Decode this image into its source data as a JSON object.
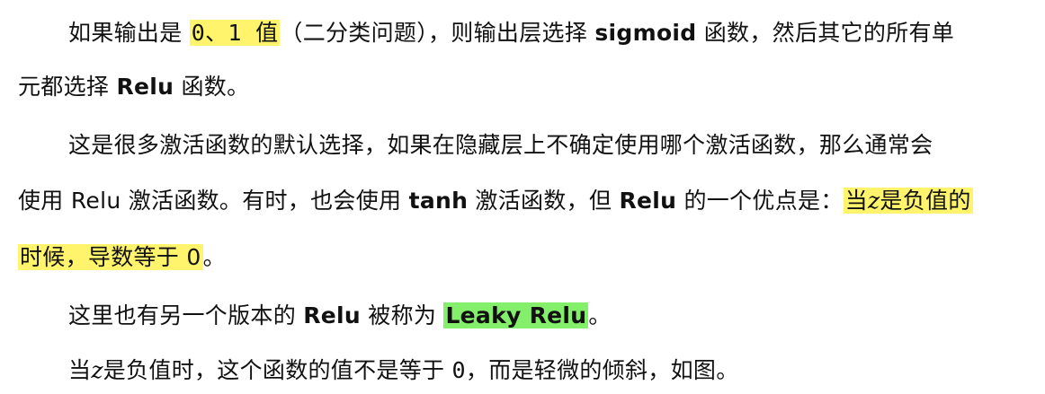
{
  "colors": {
    "highlight_yellow": "#fff46b",
    "highlight_green": "#84ef6a",
    "text": "#111111",
    "background": "#ffffff"
  },
  "p1": {
    "t1": "如果输出是 ",
    "hl": "0、1 值",
    "t2": "（二分类问题），则输出层选择 ",
    "b1": "sigmoid",
    "t3": " 函数，然后其它的所有单",
    "line2_t1": "元都选择 ",
    "line2_b1": "Relu",
    "line2_t2": " 函数。"
  },
  "p2": {
    "t1": "这是很多激活函数的默认选择，如果在隐藏层上不确定使用哪个激活函数，那么通常会",
    "line2_t1": "使用 Relu 激活函数。有时，也会使用 ",
    "line2_b1": "tanh",
    "line2_t2": " 激活函数，但 ",
    "line2_b2": "Relu",
    "line2_t3": " 的一个优点是：",
    "line2_hl_a": "当",
    "line2_hl_z": "z",
    "line2_hl_b": "是负值的",
    "line3_hl": "时候，导数等于 0",
    "line3_t1": "。"
  },
  "p3": {
    "t1": "这里也有另一个版本的 ",
    "b1": "Relu",
    "t2": " 被称为 ",
    "hl": "Leaky Relu",
    "t3": "。"
  },
  "p4": {
    "t1": "当",
    "z": "z",
    "t2": "是负值时，这个函数的值不是等于 ",
    "zero": "0",
    "t3": "，而是轻微的倾斜，如图。"
  }
}
